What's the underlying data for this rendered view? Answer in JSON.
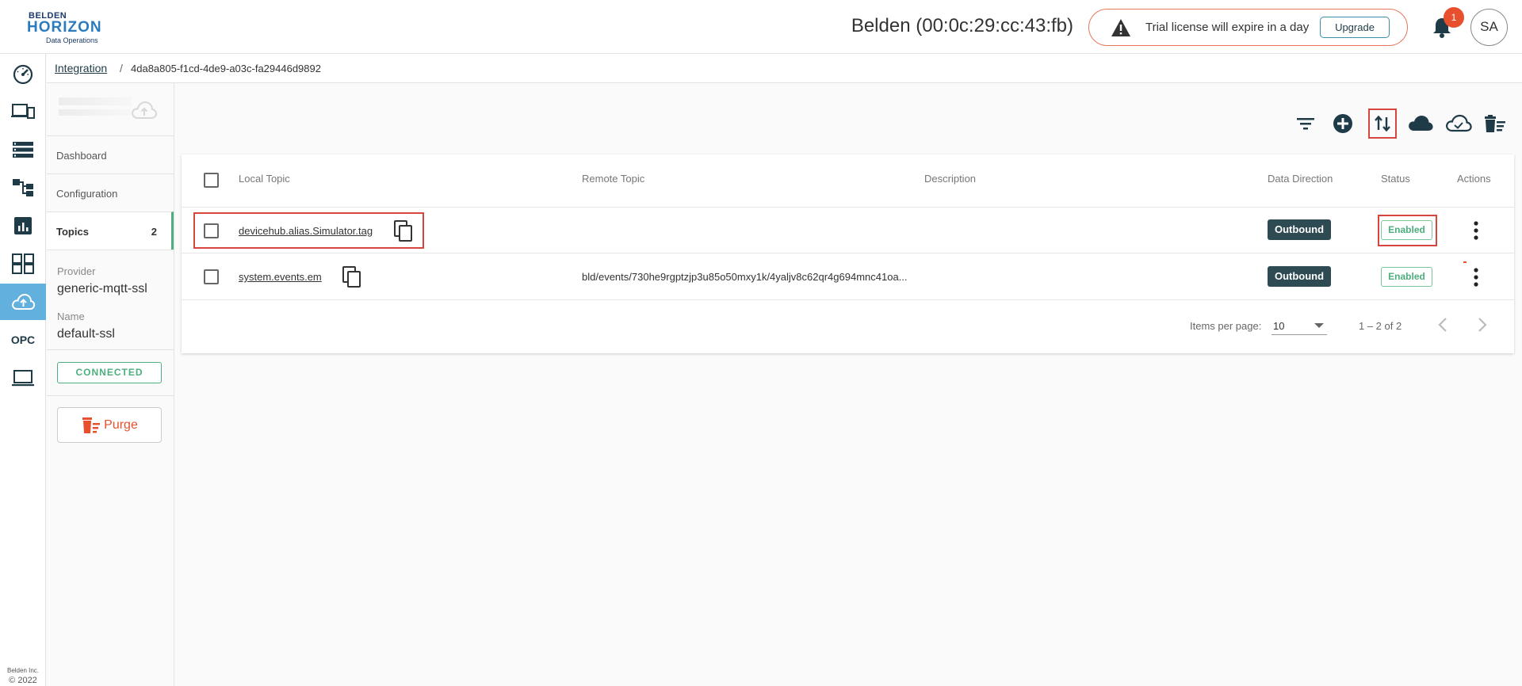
{
  "header": {
    "logo_top": "BELDEN",
    "logo_main": "HORIZON",
    "logo_sub": "Data Operations",
    "device_title": "Belden (00:0c:29:cc:43:fb)",
    "license_text": "Trial license will expire in a day",
    "upgrade_label": "Upgrade",
    "notification_count": "1",
    "avatar_initials": "SA"
  },
  "nav": {
    "items": [
      "gauge-icon",
      "devices-icon",
      "list-icon",
      "tree-icon",
      "report-icon",
      "apps-icon",
      "cloud-upload-icon",
      "opc-icon",
      "laptop-icon"
    ],
    "active": "cloud-upload-icon",
    "opc_label": "OPC",
    "copyright_company": "Belden Inc.",
    "copyright_year": "© 2022"
  },
  "breadcrumb": {
    "parent": "Integration",
    "separator": "/",
    "current": "4da8a805-f1cd-4de9-a03c-fa29446d9892"
  },
  "subpanel": {
    "tabs": [
      {
        "label": "Dashboard"
      },
      {
        "label": "Configuration"
      },
      {
        "label": "Topics",
        "count": "2"
      }
    ],
    "provider_label": "Provider",
    "provider_value": "generic-mqtt-ssl",
    "name_label": "Name",
    "name_value": "default-ssl",
    "status": "CONNECTED",
    "purge_label": "Purge"
  },
  "toolbar": {
    "icons": [
      "filter-icon",
      "add-circle-icon",
      "swap-vertical-icon",
      "cloud-icon",
      "cloud-outline-icon",
      "delete-sweep-icon"
    ],
    "highlighted": "swap-vertical-icon"
  },
  "table": {
    "columns": [
      "Local Topic",
      "Remote Topic",
      "Description",
      "Data Direction",
      "Status",
      "Actions"
    ],
    "rows": [
      {
        "local_topic": "devicehub.alias.Simulator.tag",
        "remote_topic": "",
        "description": "",
        "direction": "Outbound",
        "status": "Enabled"
      },
      {
        "local_topic": "system.events.em",
        "remote_topic": "bld/events/730he9rgptzjp3u85o50mxy1k/4yaljv8c62qr4g694mnc41oa...",
        "description": "",
        "direction": "Outbound",
        "status": "Enabled"
      }
    ]
  },
  "pagination": {
    "items_per_page_label": "Items per page:",
    "items_per_page": "10",
    "range": "1 – 2 of 2"
  },
  "colors": {
    "accent": "#62b0dd",
    "success": "#4caf7d",
    "danger": "#e8502d",
    "badge_dark": "#2e4a52",
    "highlight": "#d8453c"
  }
}
